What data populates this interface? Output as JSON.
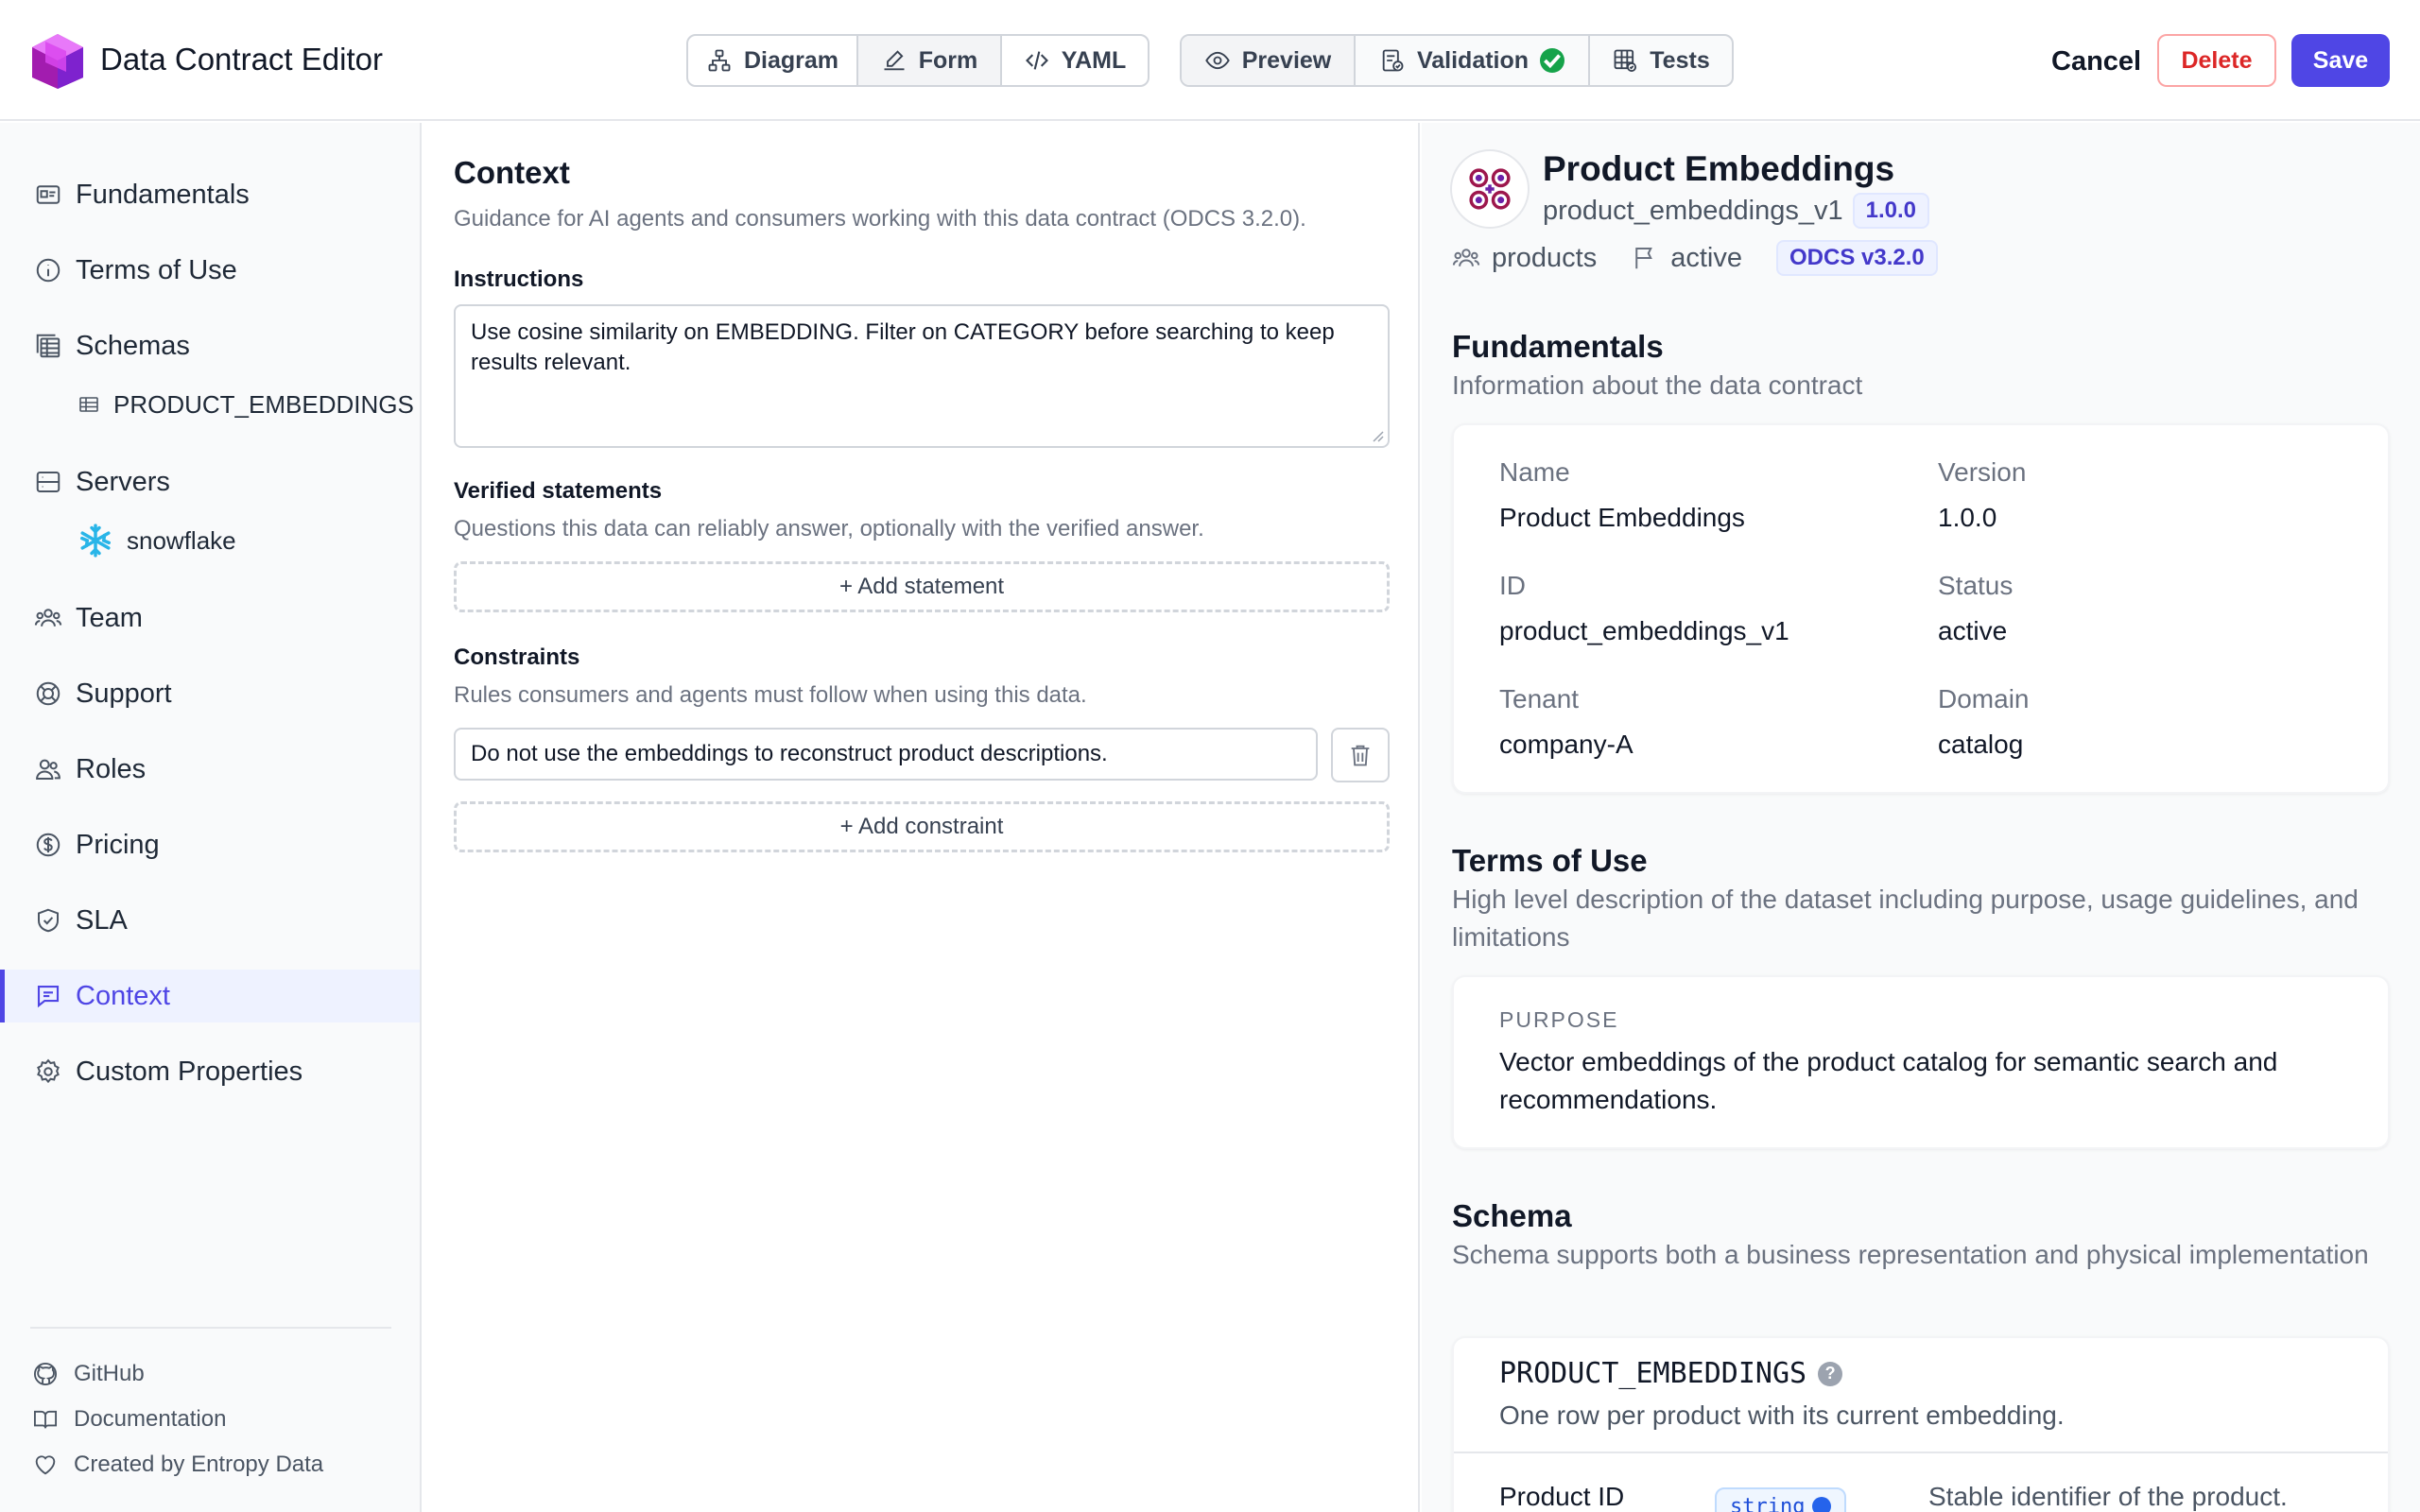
{
  "header": {
    "app_title": "Data Contract Editor",
    "view_tabs": [
      {
        "label": "Diagram",
        "icon": "diagram-icon"
      },
      {
        "label": "Form",
        "icon": "form-edit-icon"
      },
      {
        "label": "YAML",
        "icon": "code-icon"
      }
    ],
    "mode_tabs": [
      {
        "label": "Preview",
        "icon": "eye-icon"
      },
      {
        "label": "Validation",
        "icon": "validation-icon",
        "status": "valid"
      },
      {
        "label": "Tests",
        "icon": "tests-icon"
      }
    ],
    "cancel_label": "Cancel",
    "delete_label": "Delete",
    "save_label": "Save"
  },
  "sidebar": {
    "items": [
      {
        "label": "Fundamentals",
        "icon": "id-card-icon"
      },
      {
        "label": "Terms of Use",
        "icon": "info-icon"
      },
      {
        "label": "Schemas",
        "icon": "schemas-icon"
      },
      {
        "label": "Servers",
        "icon": "server-icon"
      },
      {
        "label": "Team",
        "icon": "team-icon"
      },
      {
        "label": "Support",
        "icon": "support-icon"
      },
      {
        "label": "Roles",
        "icon": "roles-icon"
      },
      {
        "label": "Pricing",
        "icon": "dollar-icon"
      },
      {
        "label": "SLA",
        "icon": "shield-check-icon"
      },
      {
        "label": "Context",
        "icon": "chat-icon",
        "active": true
      },
      {
        "label": "Custom Properties",
        "icon": "gear-icon"
      }
    ],
    "schema_children": [
      "PRODUCT_EMBEDDINGS"
    ],
    "server_children": [
      "snowflake"
    ],
    "footer": [
      {
        "label": "GitHub",
        "icon": "github-icon"
      },
      {
        "label": "Documentation",
        "icon": "book-icon"
      },
      {
        "label": "Created by Entropy Data",
        "icon": "heart-icon"
      }
    ]
  },
  "form": {
    "title": "Context",
    "description": "Guidance for AI agents and consumers working with this data contract (ODCS 3.2.0).",
    "instructions_label": "Instructions",
    "instructions_value": "Use cosine similarity on EMBEDDING. Filter on CATEGORY before searching to keep results relevant.",
    "verified_label": "Verified statements",
    "verified_help": "Questions this data can reliably answer, optionally with the verified answer.",
    "add_statement_label": "+ Add statement",
    "constraints_label": "Constraints",
    "constraints_help": "Rules consumers and agents must follow when using this data.",
    "constraints": [
      "Do not use the embeddings to reconstruct product descriptions."
    ],
    "add_constraint_label": "+ Add constraint"
  },
  "preview": {
    "title": "Product Embeddings",
    "id": "product_embeddings_v1",
    "version_badge": "1.0.0",
    "domain_tag": "products",
    "status_tag": "active",
    "spec_badge": "ODCS v3.2.0",
    "fundamentals": {
      "title": "Fundamentals",
      "subtitle": "Information about the data contract",
      "fields": [
        {
          "label": "Name",
          "value": "Product Embeddings"
        },
        {
          "label": "Version",
          "value": "1.0.0"
        },
        {
          "label": "ID",
          "value": "product_embeddings_v1"
        },
        {
          "label": "Status",
          "value": "active"
        },
        {
          "label": "Tenant",
          "value": "company-A"
        },
        {
          "label": "Domain",
          "value": "catalog"
        }
      ]
    },
    "terms": {
      "title": "Terms of Use",
      "subtitle": "High level description of the dataset including purpose, usage guidelines, and limitations",
      "purpose_label": "PURPOSE",
      "purpose_text": "Vector embeddings of the product catalog for semantic search and recommendations."
    },
    "schema": {
      "title": "Schema",
      "subtitle": "Schema supports both a business representation and physical implementation",
      "table_name": "PRODUCT_EMBEDDINGS",
      "table_desc": "One row per product with its current embedding.",
      "first_column": {
        "name": "Product ID",
        "type": "string",
        "desc": "Stable identifier of the product."
      }
    }
  },
  "colors": {
    "accent": "#4f46e5",
    "danger": "#dc2626",
    "success": "#16a34a",
    "snowflake": "#29b5e8"
  }
}
